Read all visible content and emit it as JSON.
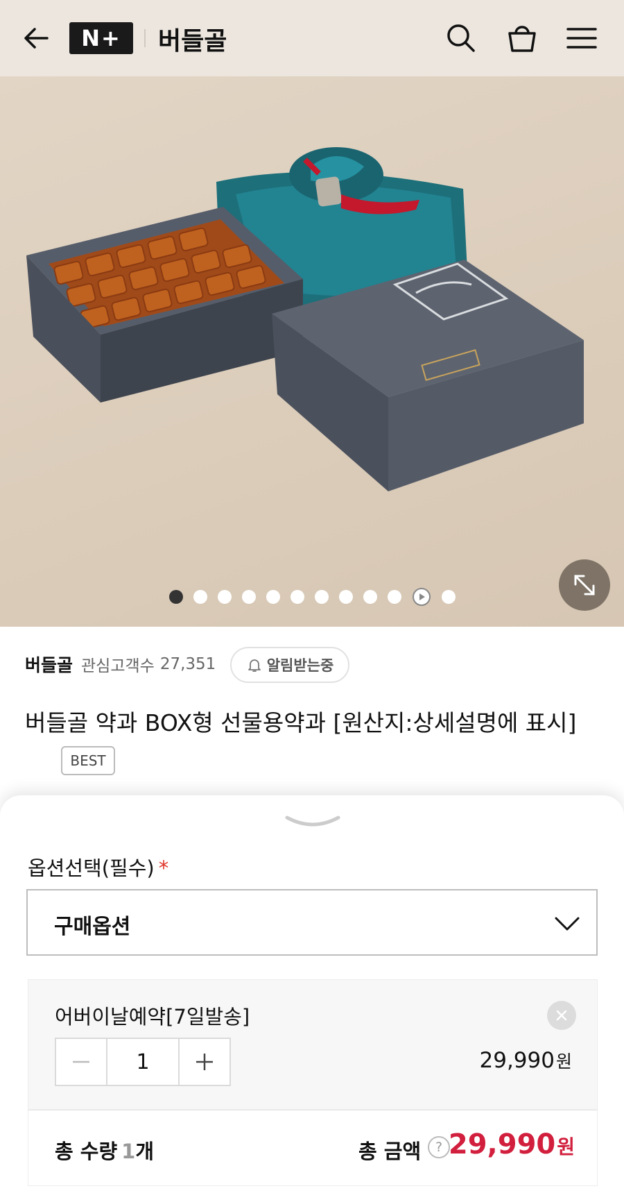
{
  "header": {
    "logo": "N+",
    "title": "버들골",
    "icons": [
      "back-arrow-icon",
      "search-icon",
      "cart-icon",
      "menu-icon"
    ]
  },
  "gallery": {
    "dot_count": 12,
    "active_index": 0,
    "video_index": 10,
    "icons": [
      "play-icon",
      "expand-icon"
    ]
  },
  "store": {
    "name": "버들골",
    "fans_label": "관심고객수",
    "fans_count": "27,351",
    "notify_label": "알림받는중"
  },
  "product": {
    "title": "버들골 약과 BOX형 선물용약과 [원산지:상세설명에 표시]",
    "badge": "BEST"
  },
  "sheet": {
    "option_label": "옵션선택(필수)",
    "required_mark": "*",
    "select_value": "구매옵션",
    "selected_option": {
      "name": "어버이날예약[7일발송]",
      "quantity": "1",
      "price": "29,990",
      "price_unit": "원"
    },
    "total": {
      "qty_label": "총 수량",
      "qty_value": "1",
      "qty_unit": "개",
      "amount_label": "총 금액",
      "help": "?",
      "amount": "29,990",
      "amount_unit": "원"
    }
  },
  "colors": {
    "header_bg": "#ece6de",
    "accent_price": "#d11f3d",
    "required": "#e0362b"
  }
}
